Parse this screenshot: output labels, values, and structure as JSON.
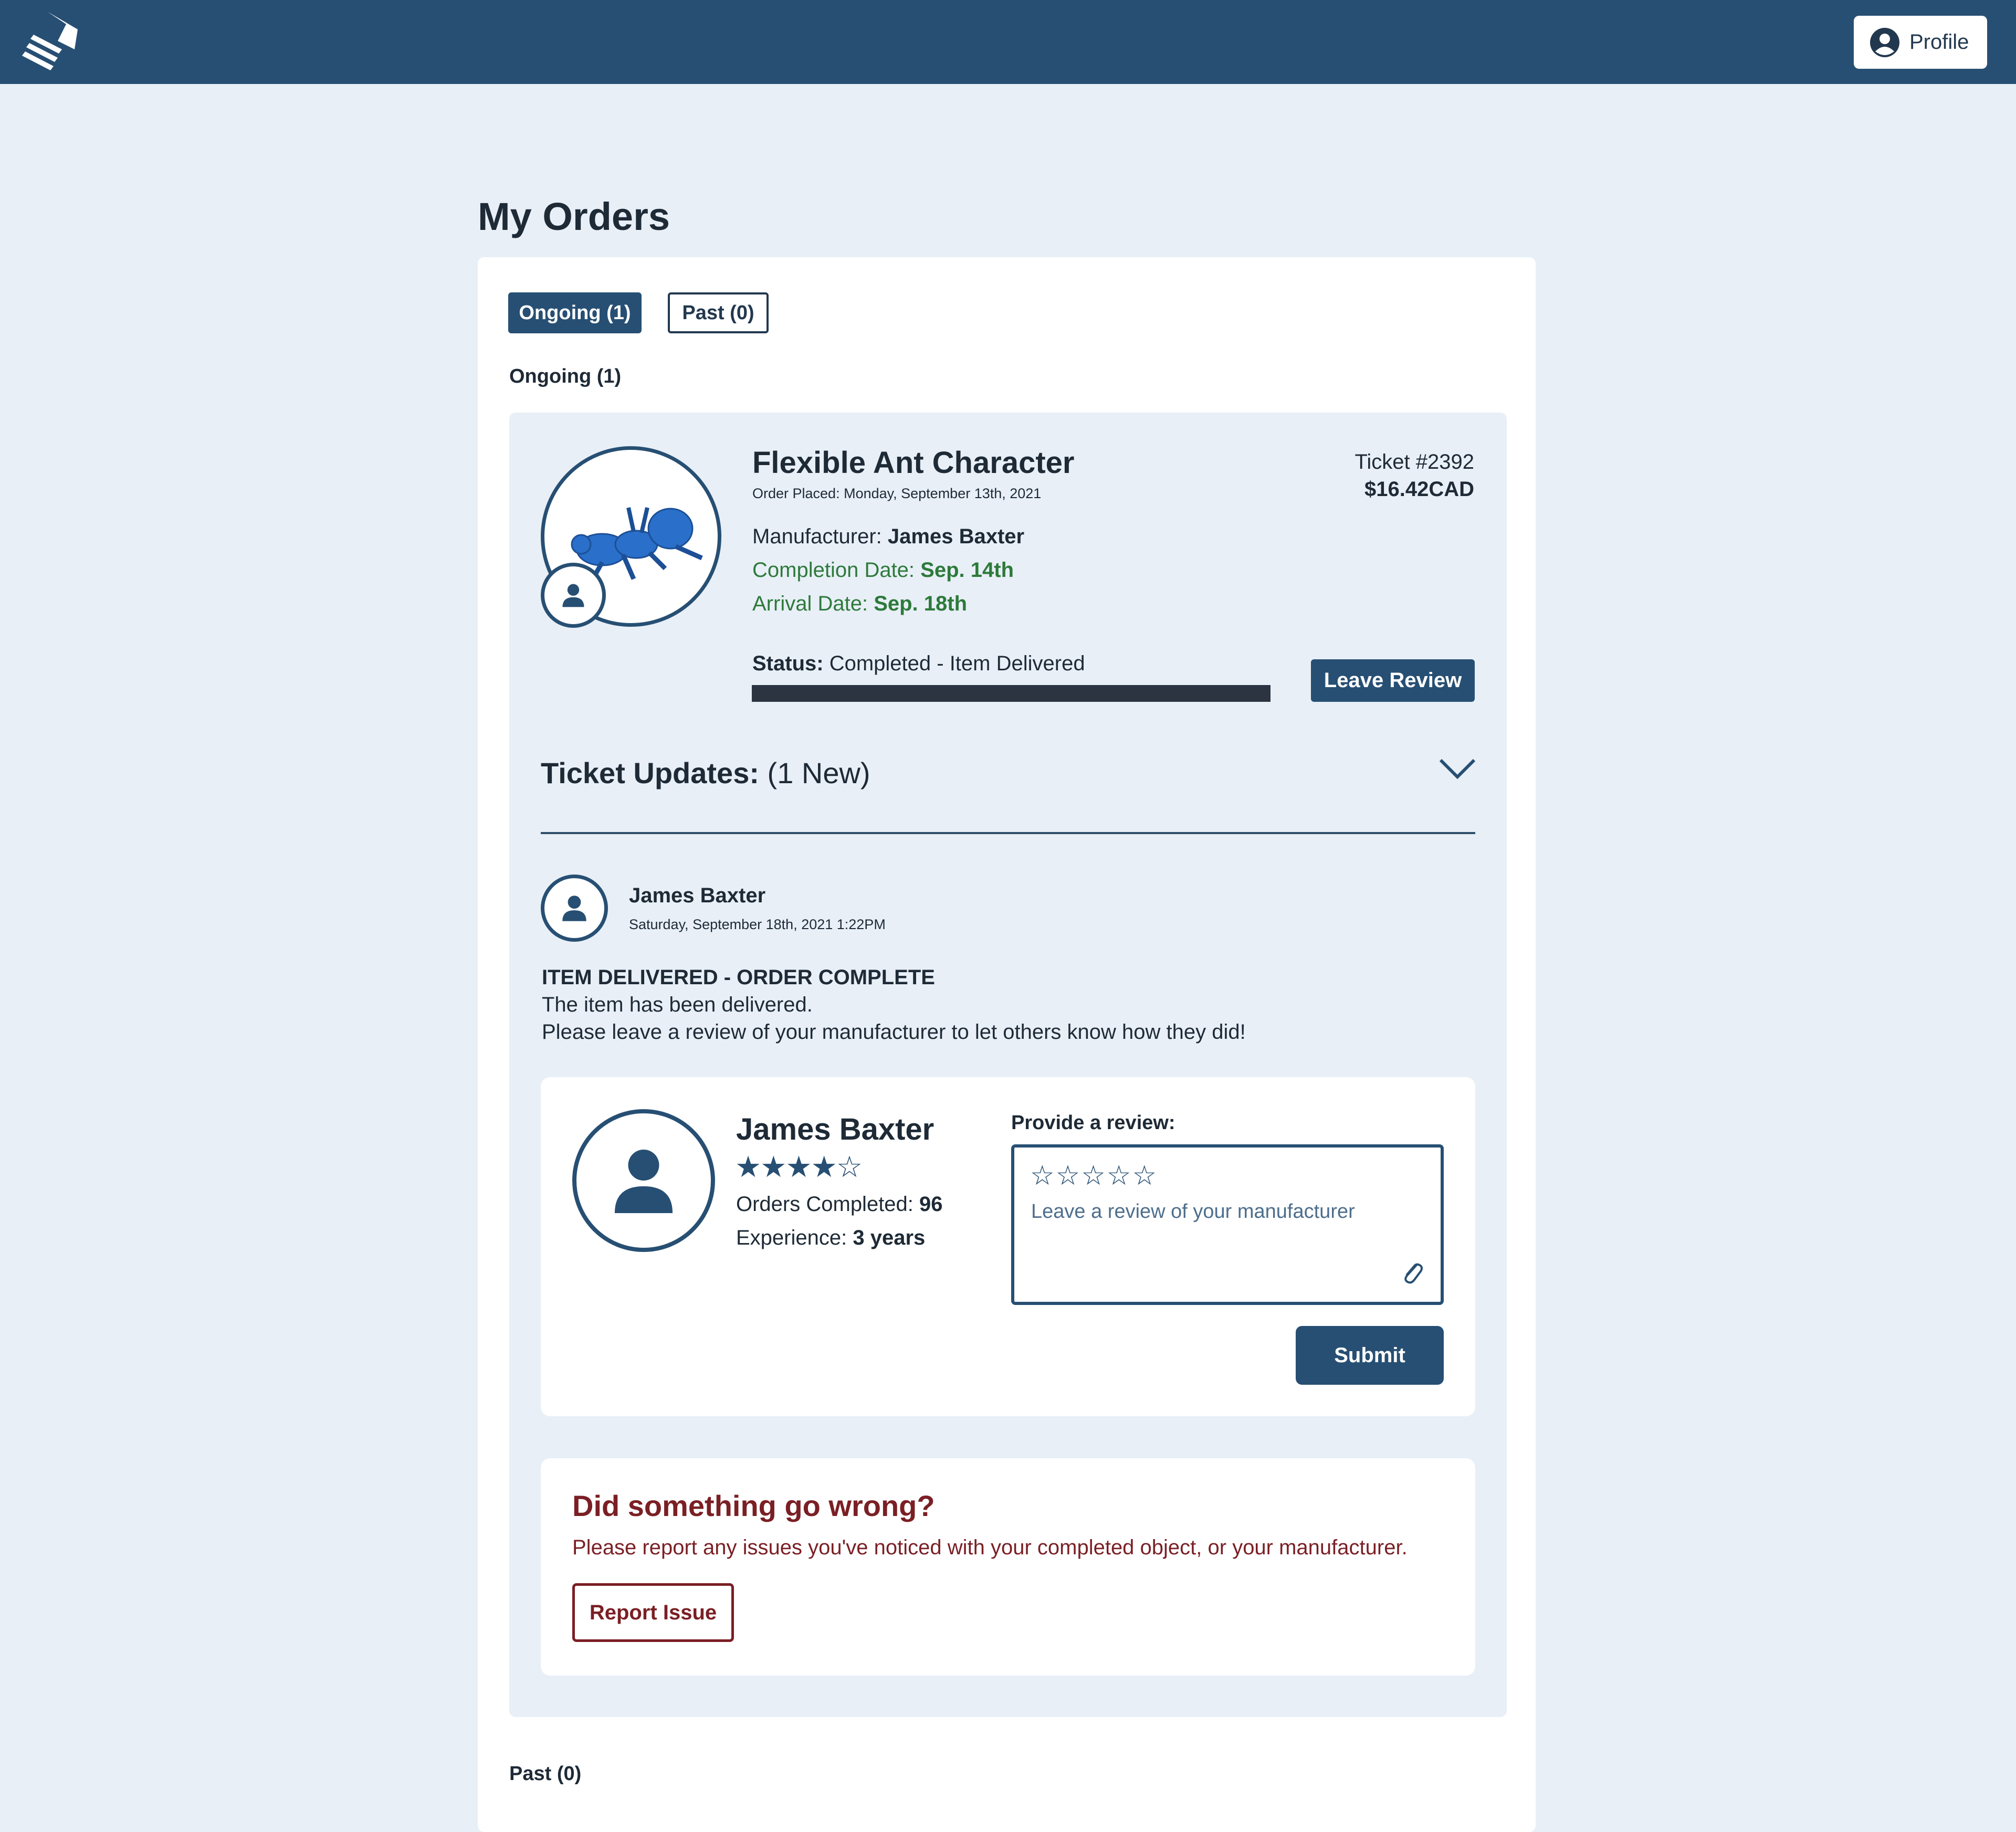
{
  "header": {
    "profile_label": "Profile"
  },
  "page": {
    "title": "My Orders"
  },
  "tabs": [
    {
      "label": "Ongoing (1)",
      "active": true
    },
    {
      "label": "Past (0)",
      "active": false
    }
  ],
  "sections": {
    "ongoing_label": "Ongoing (1)",
    "past_label": "Past (0)"
  },
  "order": {
    "title": "Flexible Ant Character",
    "order_placed": "Order Placed: Monday, September 13th, 2021",
    "ticket": "Ticket #2392",
    "price": "$16.42CAD",
    "manufacturer_label": "Manufacturer:",
    "manufacturer": "James Baxter",
    "completion_label": "Completion Date:",
    "completion_date": "Sep. 14th",
    "arrival_label": "Arrival Date:",
    "arrival_date": "Sep. 18th",
    "status_label": "Status:",
    "status": "Completed - Item Delivered",
    "progress": 1.0,
    "leave_review_label": "Leave Review"
  },
  "updates": {
    "title": "Ticket Updates:",
    "count": "(1 New)",
    "items": [
      {
        "author": "James Baxter",
        "timestamp": "Saturday, September 18th, 2021 1:22PM",
        "heading": "ITEM DELIVERED - ORDER COMPLETE",
        "lines": [
          "The item has been delivered.",
          "Please leave a review of your manufacturer to let others know how they did!"
        ]
      }
    ]
  },
  "review": {
    "manufacturer_name": "James Baxter",
    "rating_stars": "★★★★☆",
    "rating": 4,
    "orders_label": "Orders Completed:",
    "orders_value": "96",
    "experience_label": "Experience:",
    "experience_value": "3 years",
    "provide_label": "Provide a review:",
    "input_stars": "☆☆☆☆☆",
    "placeholder": "Leave a review of your manufacturer",
    "submit_label": "Submit"
  },
  "issue": {
    "title": "Did something go wrong?",
    "text": "Please report any issues you've noticed with your completed object, or your manufacturer.",
    "button_label": "Report Issue"
  },
  "colors": {
    "brand": "#274f73",
    "background": "#e8eff7",
    "success": "#2d7a3a",
    "danger": "#7a1f24"
  },
  "icons": [
    "logo-icon",
    "user-circle-icon",
    "user-icon",
    "chevron-down-icon",
    "paperclip-icon",
    "ant-model-image"
  ]
}
